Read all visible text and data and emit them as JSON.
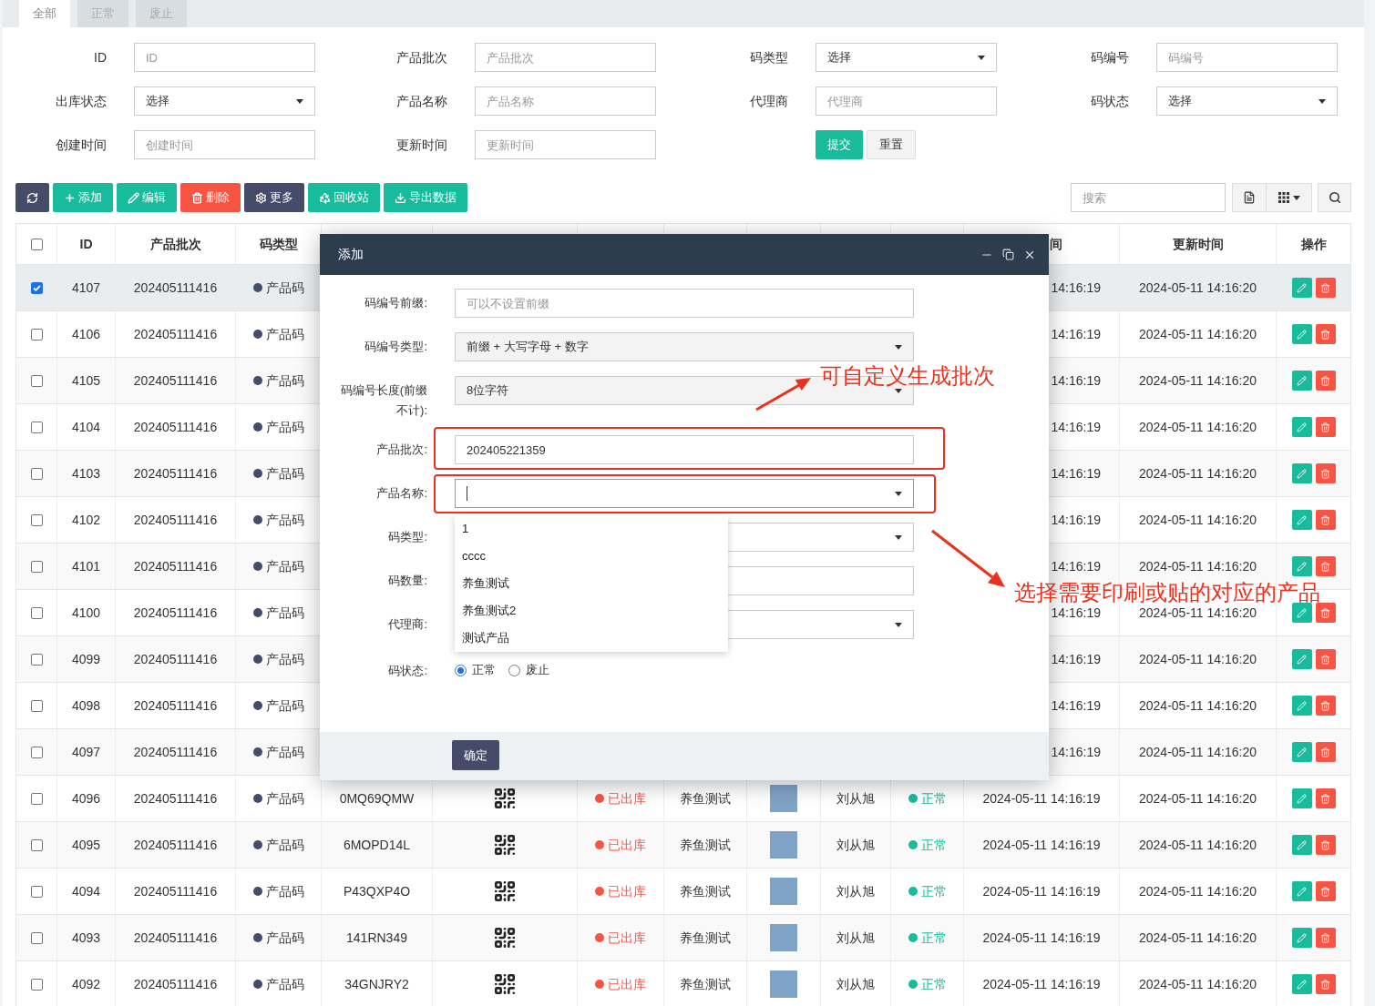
{
  "tabs": [
    {
      "label": "全部",
      "selected": true
    },
    {
      "label": "正常",
      "selected": false
    },
    {
      "label": "废止",
      "selected": false
    }
  ],
  "filters": [
    {
      "label": "ID",
      "kind": "input",
      "placeholder": "ID"
    },
    {
      "label": "产品批次",
      "kind": "input",
      "placeholder": "产品批次"
    },
    {
      "label": "码类型",
      "kind": "select",
      "value": "选择"
    },
    {
      "label": "码编号",
      "kind": "input",
      "placeholder": "码编号"
    },
    {
      "label": "出库状态",
      "kind": "select",
      "value": "选择"
    },
    {
      "label": "产品名称",
      "kind": "input",
      "placeholder": "产品名称"
    },
    {
      "label": "代理商",
      "kind": "input",
      "placeholder": "代理商"
    },
    {
      "label": "码状态",
      "kind": "select",
      "value": "选择"
    },
    {
      "label": "创建时间",
      "kind": "input",
      "placeholder": "创建时间"
    },
    {
      "label": "更新时间",
      "kind": "input",
      "placeholder": "更新时间"
    }
  ],
  "filter_buttons": [
    {
      "label": "提交",
      "kind": "primary"
    },
    {
      "label": "重置",
      "kind": "default"
    }
  ],
  "toolbar": [
    {
      "kind": "refresh"
    },
    {
      "kind": "add",
      "label": "添加"
    },
    {
      "kind": "edit",
      "label": "编辑"
    },
    {
      "kind": "delete",
      "label": "删除"
    },
    {
      "kind": "more",
      "label": "更多"
    },
    {
      "kind": "recycle",
      "label": "回收站"
    },
    {
      "kind": "export",
      "label": "导出数据"
    }
  ],
  "search": {
    "placeholder": "搜索"
  },
  "table": {
    "select_all": {
      "checked": false
    },
    "columns": [
      "ID",
      "产品批次",
      "码类型",
      "间",
      "更新时间",
      "操作"
    ],
    "rows": [
      {
        "id": "4107",
        "batch": "202405111416",
        "code_type": "产品码",
        "selected": true,
        "created": "14:16:19",
        "updated": "2024-05-11 14:16:20"
      },
      {
        "id": "4106",
        "batch": "202405111416",
        "code_type": "产品码",
        "selected": false,
        "created": "14:16:19",
        "updated": "2024-05-11 14:16:20"
      },
      {
        "id": "4105",
        "batch": "202405111416",
        "code_type": "产品码",
        "selected": false,
        "created": "14:16:19",
        "updated": "2024-05-11 14:16:20"
      },
      {
        "id": "4104",
        "batch": "202405111416",
        "code_type": "产品码",
        "selected": false,
        "created": "14:16:19",
        "updated": "2024-05-11 14:16:20"
      },
      {
        "id": "4103",
        "batch": "202405111416",
        "code_type": "产品码",
        "selected": false,
        "created": "14:16:19",
        "updated": "2024-05-11 14:16:20"
      },
      {
        "id": "4102",
        "batch": "202405111416",
        "code_type": "产品码",
        "selected": false,
        "created": "14:16:19",
        "updated": "2024-05-11 14:16:20"
      },
      {
        "id": "4101",
        "batch": "202405111416",
        "code_type": "产品码",
        "selected": false,
        "created": "14:16:19",
        "updated": "2024-05-11 14:16:20"
      },
      {
        "id": "4100",
        "batch": "202405111416",
        "code_type": "产品码",
        "selected": false,
        "created": "14:16:19",
        "updated": "2024-05-11 14:16:20"
      },
      {
        "id": "4099",
        "batch": "202405111416",
        "code_type": "产品码",
        "selected": false,
        "created": "14:16:19",
        "updated": "2024-05-11 14:16:20"
      },
      {
        "id": "4098",
        "batch": "202405111416",
        "code_type": "产品码",
        "selected": false,
        "created": "14:16:19",
        "updated": "2024-05-11 14:16:20"
      },
      {
        "id": "4097",
        "batch": "202405111416",
        "code_type": "产品码",
        "selected": false,
        "created": "14:16:19",
        "updated": "2024-05-11 14:16:20"
      },
      {
        "id": "4096",
        "batch": "202405111416",
        "code_type": "产品码",
        "selected": false,
        "code_no": "0MQ69QMW",
        "out_status": "已出库",
        "product": "养鱼测试",
        "agent": "刘从旭",
        "status": "正常",
        "created": "2024-05-11 14:16:19",
        "updated": "2024-05-11 14:16:20"
      },
      {
        "id": "4095",
        "batch": "202405111416",
        "code_type": "产品码",
        "selected": false,
        "code_no": "6MOPD14L",
        "out_status": "已出库",
        "product": "养鱼测试",
        "agent": "刘从旭",
        "status": "正常",
        "created": "2024-05-11 14:16:19",
        "updated": "2024-05-11 14:16:20"
      },
      {
        "id": "4094",
        "batch": "202405111416",
        "code_type": "产品码",
        "selected": false,
        "code_no": "P43QXP4O",
        "out_status": "已出库",
        "product": "养鱼测试",
        "agent": "刘从旭",
        "status": "正常",
        "created": "2024-05-11 14:16:19",
        "updated": "2024-05-11 14:16:20"
      },
      {
        "id": "4093",
        "batch": "202405111416",
        "code_type": "产品码",
        "selected": false,
        "code_no": "141RN349",
        "out_status": "已出库",
        "product": "养鱼测试",
        "agent": "刘从旭",
        "status": "正常",
        "created": "2024-05-11 14:16:19",
        "updated": "2024-05-11 14:16:20"
      },
      {
        "id": "4092",
        "batch": "202405111416",
        "code_type": "产品码",
        "selected": false,
        "code_no": "34GNJRY2",
        "out_status": "已出库",
        "product": "养鱼测试",
        "agent": "刘从旭",
        "status": "正常",
        "created": "2024-05-11 14:16:19",
        "updated": "2024-05-11 14:16:20"
      }
    ]
  },
  "dialog": {
    "title": "添加",
    "fields": [
      {
        "label": "码编号前缀:",
        "kind": "input",
        "placeholder": "可以不设置前缀",
        "disabled": false
      },
      {
        "label": "码编号类型:",
        "kind": "select",
        "value": "前缀 + 大写字母 + 数字",
        "disabled": true,
        "expanded": false
      },
      {
        "label": "码编号长度(前缀不计):",
        "kind": "select",
        "value": "8位字符",
        "disabled": true,
        "expanded": false
      },
      {
        "label": "产品批次:",
        "kind": "input",
        "value": "202405221359",
        "disabled": false
      },
      {
        "label": "产品名称:",
        "kind": "select",
        "disabled": false,
        "expanded": true,
        "options": [
          "1",
          "cccc",
          "养鱼测试",
          "养鱼测试2",
          "测试产品"
        ]
      },
      {
        "label": "码类型:",
        "kind": "select",
        "disabled": false,
        "expanded": false
      },
      {
        "label": "码数量:",
        "kind": "input",
        "disabled": false
      },
      {
        "label": "代理商:",
        "kind": "select",
        "disabled": false,
        "expanded": false
      },
      {
        "label": "码状态:",
        "kind": "radio",
        "options": [
          {
            "label": "正常",
            "selected": true
          },
          {
            "label": "废止",
            "selected": false
          }
        ]
      }
    ],
    "confirm": "确定"
  },
  "annotations": [
    {
      "text": "可自定义生成批次"
    },
    {
      "text": "选择需要印刷或贴的对应的产品"
    }
  ]
}
